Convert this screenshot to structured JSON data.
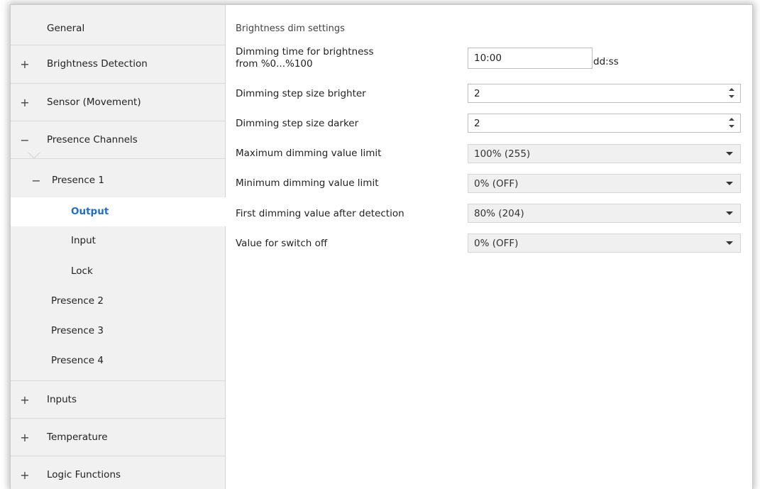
{
  "sidebar": {
    "items": [
      {
        "sign": "",
        "label": "General"
      },
      {
        "sign": "+",
        "label": "Brightness Detection"
      },
      {
        "sign": "+",
        "label": "Sensor (Movement)"
      },
      {
        "sign": "−",
        "label": "Presence Channels"
      },
      {
        "sign": "−",
        "label": "Presence 1"
      },
      {
        "sign": "",
        "label": "Output",
        "active": true
      },
      {
        "sign": "",
        "label": "Input"
      },
      {
        "sign": "",
        "label": "Lock"
      },
      {
        "sign": "",
        "label": "Presence 2"
      },
      {
        "sign": "",
        "label": "Presence 3"
      },
      {
        "sign": "",
        "label": "Presence 4"
      },
      {
        "sign": "+",
        "label": "Inputs"
      },
      {
        "sign": "+",
        "label": "Temperature"
      },
      {
        "sign": "+",
        "label": "Logic Functions"
      }
    ],
    "active_color": "#1e6fbf"
  },
  "main": {
    "section_title": "Brightness dim settings",
    "dimming_time": {
      "label_line1": "Dimming time for brightness",
      "label_line2": "from %0...%100",
      "value": "10:00",
      "unit": "dd:ss"
    },
    "step_brighter": {
      "label": "Dimming step size brighter",
      "value": "2"
    },
    "step_darker": {
      "label": "Dimming step size darker",
      "value": "2"
    },
    "max_limit": {
      "label": "Maximum dimming value limit",
      "value": "100% (255)"
    },
    "min_limit": {
      "label": "Minimum dimming value limit",
      "value": "0% (OFF)"
    },
    "first_value": {
      "label": "First dimming value after detection",
      "value": "80% (204)"
    },
    "switch_off": {
      "label": "Value for switch off",
      "value": "0% (OFF)"
    }
  }
}
